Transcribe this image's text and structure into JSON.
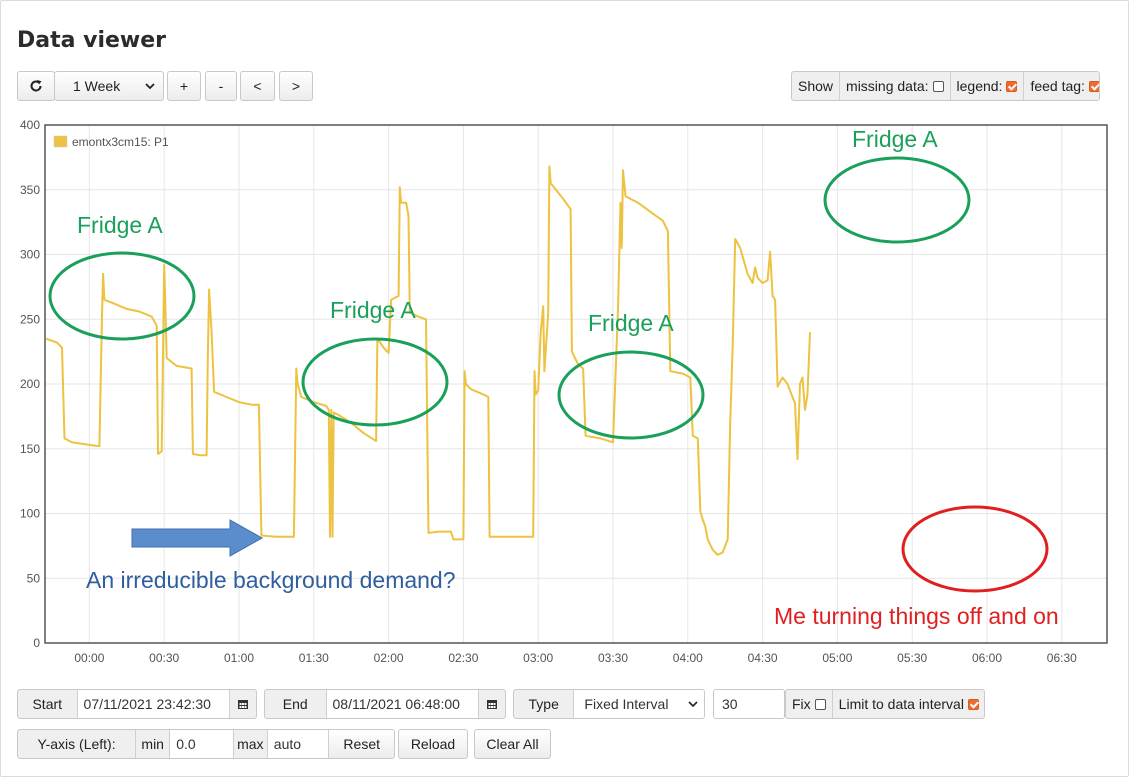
{
  "page": {
    "title": "Data viewer"
  },
  "toolbar": {
    "reload_icon": "refresh-icon",
    "range_select": "1 Week",
    "zoom_in": "+",
    "zoom_out": "-",
    "pan_left": "<",
    "pan_right": ">",
    "show_label": "Show",
    "missing_data_label": "missing data:",
    "missing_data_checked": false,
    "legend_label": "legend:",
    "legend_checked": true,
    "feed_tag_label": "feed tag:",
    "feed_tag_checked": true
  },
  "colors": {
    "series": "#edc240",
    "accent": "#f06b30",
    "fridge_ellipse": "#1aa05a",
    "fridge_text": "#1aa05a",
    "arrow": "#5b8dcc",
    "note_text": "#2f5e9e",
    "red": "#e02020"
  },
  "chart_data": {
    "type": "line",
    "xlabel": "",
    "ylabel": "",
    "ylim": [
      0,
      400
    ],
    "yticks": [
      0,
      50,
      100,
      150,
      200,
      250,
      300,
      350,
      400
    ],
    "xlim": [
      "00:29 before 00:00",
      "07:00"
    ],
    "xticks": [
      "00:00",
      "00:30",
      "01:00",
      "01:30",
      "02:00",
      "02:30",
      "03:00",
      "03:30",
      "04:00",
      "04:30",
      "05:00",
      "05:30",
      "06:00",
      "06:30"
    ],
    "grid": true,
    "legend_position": "top-left",
    "series": [
      {
        "name": "emontx3cm15: P1",
        "points": [
          [
            "23:42:30",
            235
          ],
          [
            "23:47",
            232
          ],
          [
            "23:49",
            228
          ],
          [
            "23:50",
            158
          ],
          [
            "23:53",
            155
          ],
          [
            "00:00",
            153
          ],
          [
            "00:04",
            152
          ],
          [
            "00:05",
            250
          ],
          [
            "00:05:30",
            285
          ],
          [
            "00:06",
            265
          ],
          [
            "00:10",
            262
          ],
          [
            "00:15",
            258
          ],
          [
            "00:20",
            256
          ],
          [
            "00:25",
            252
          ],
          [
            "00:27",
            245
          ],
          [
            "00:27:30",
            146
          ],
          [
            "00:29",
            148
          ],
          [
            "00:30",
            292
          ],
          [
            "00:31",
            220
          ],
          [
            "00:35",
            214
          ],
          [
            "00:41",
            212
          ],
          [
            "00:41:30",
            146
          ],
          [
            "00:44",
            145
          ],
          [
            "00:47",
            145
          ],
          [
            "00:47:30",
            220
          ],
          [
            "00:48",
            273
          ],
          [
            "00:49",
            240
          ],
          [
            "00:50",
            194
          ],
          [
            "00:55",
            190
          ],
          [
            "01:00",
            186
          ],
          [
            "01:05",
            184
          ],
          [
            "01:08",
            184
          ],
          [
            "01:09",
            83
          ],
          [
            "01:15",
            82
          ],
          [
            "01:22",
            82
          ],
          [
            "01:23",
            212
          ],
          [
            "01:23:30",
            200
          ],
          [
            "01:25",
            190
          ],
          [
            "01:30",
            186
          ],
          [
            "01:35",
            183
          ],
          [
            "01:36",
            180
          ],
          [
            "01:36:30",
            82
          ],
          [
            "01:37",
            180
          ],
          [
            "01:37:30",
            82
          ],
          [
            "01:38",
            178
          ],
          [
            "01:40",
            176
          ],
          [
            "01:45",
            170
          ],
          [
            "01:50",
            162
          ],
          [
            "01:55",
            156
          ],
          [
            "01:55:30",
            235
          ],
          [
            "01:58",
            228
          ],
          [
            "02:00",
            224
          ],
          [
            "02:01",
            265
          ],
          [
            "02:04",
            268
          ],
          [
            "02:04:30",
            352
          ],
          [
            "02:05",
            340
          ],
          [
            "02:07",
            340
          ],
          [
            "02:08",
            330
          ],
          [
            "02:08:30",
            255
          ],
          [
            "02:12",
            252
          ],
          [
            "02:15",
            250
          ],
          [
            "02:16",
            85
          ],
          [
            "02:20",
            86
          ],
          [
            "02:25",
            86
          ],
          [
            "02:26",
            80
          ],
          [
            "02:30",
            80
          ],
          [
            "02:30:30",
            210
          ],
          [
            "02:31",
            200
          ],
          [
            "02:33",
            196
          ],
          [
            "02:38",
            192
          ],
          [
            "02:40",
            190
          ],
          [
            "02:40:30",
            82
          ],
          [
            "02:45",
            82
          ],
          [
            "02:55",
            82
          ],
          [
            "02:58",
            82
          ],
          [
            "02:58:30",
            210
          ],
          [
            "02:59",
            192
          ],
          [
            "03:00",
            195
          ],
          [
            "03:01",
            240
          ],
          [
            "03:02",
            260
          ],
          [
            "03:02:30",
            210
          ],
          [
            "03:04",
            255
          ],
          [
            "03:04:30",
            368
          ],
          [
            "03:05",
            355
          ],
          [
            "03:10",
            343
          ],
          [
            "03:13",
            335
          ],
          [
            "03:13:30",
            225
          ],
          [
            "03:16",
            215
          ],
          [
            "03:18",
            212
          ],
          [
            "03:19",
            160
          ],
          [
            "03:25",
            158
          ],
          [
            "03:30",
            155
          ],
          [
            "03:32",
            258
          ],
          [
            "03:33",
            340
          ],
          [
            "03:33:30",
            305
          ],
          [
            "03:34",
            365
          ],
          [
            "03:35",
            345
          ],
          [
            "03:40",
            340
          ],
          [
            "03:45",
            333
          ],
          [
            "03:50",
            326
          ],
          [
            "03:52",
            318
          ],
          [
            "03:53",
            210
          ],
          [
            "03:58",
            208
          ],
          [
            "04:01",
            205
          ],
          [
            "04:02",
            160
          ],
          [
            "04:04",
            158
          ],
          [
            "04:05",
            102
          ],
          [
            "04:06",
            95
          ],
          [
            "04:07",
            90
          ],
          [
            "04:08",
            80
          ],
          [
            "04:10",
            72
          ],
          [
            "04:12",
            68
          ],
          [
            "04:14",
            70
          ],
          [
            "04:15",
            75
          ],
          [
            "04:16",
            80
          ],
          [
            "04:17",
            170
          ],
          [
            "04:18",
            230
          ],
          [
            "04:19",
            312
          ],
          [
            "04:21",
            305
          ],
          [
            "04:24",
            285
          ],
          [
            "04:26",
            278
          ],
          [
            "04:27",
            290
          ],
          [
            "04:28",
            282
          ],
          [
            "04:30",
            278
          ],
          [
            "04:32",
            280
          ],
          [
            "04:33",
            302
          ],
          [
            "04:34",
            268
          ],
          [
            "04:35",
            265
          ],
          [
            "04:36",
            198
          ],
          [
            "04:38",
            205
          ],
          [
            "04:40",
            200
          ],
          [
            "04:42",
            190
          ],
          [
            "04:43",
            185
          ],
          [
            "04:44",
            142
          ],
          [
            "04:45",
            200
          ],
          [
            "04:46",
            205
          ],
          [
            "04:47",
            180
          ],
          [
            "04:48",
            192
          ],
          [
            "04:49",
            240
          ]
        ]
      }
    ]
  },
  "annotations": {
    "fridge_label": "Fridge A",
    "background_note": "An irreducible background demand?",
    "switching_note": "Me turning things off and on"
  },
  "controls": {
    "start_label": "Start",
    "start_value": "07/11/2021 23:42:30",
    "end_label": "End",
    "end_value": "08/11/2021 06:48:00",
    "calendar_icon": "calendar-icon",
    "type_label": "Type",
    "type_value": "Fixed Interval",
    "interval_value": "30",
    "fix_label": "Fix",
    "fix_checked": false,
    "limit_label": "Limit to data interval",
    "limit_checked": true,
    "yaxis_label": "Y-axis (Left):",
    "min_label": "min",
    "min_value": "0.0",
    "max_label": "max",
    "max_value": "auto",
    "reset_label": "Reset",
    "reload_label": "Reload",
    "clear_label": "Clear All"
  }
}
